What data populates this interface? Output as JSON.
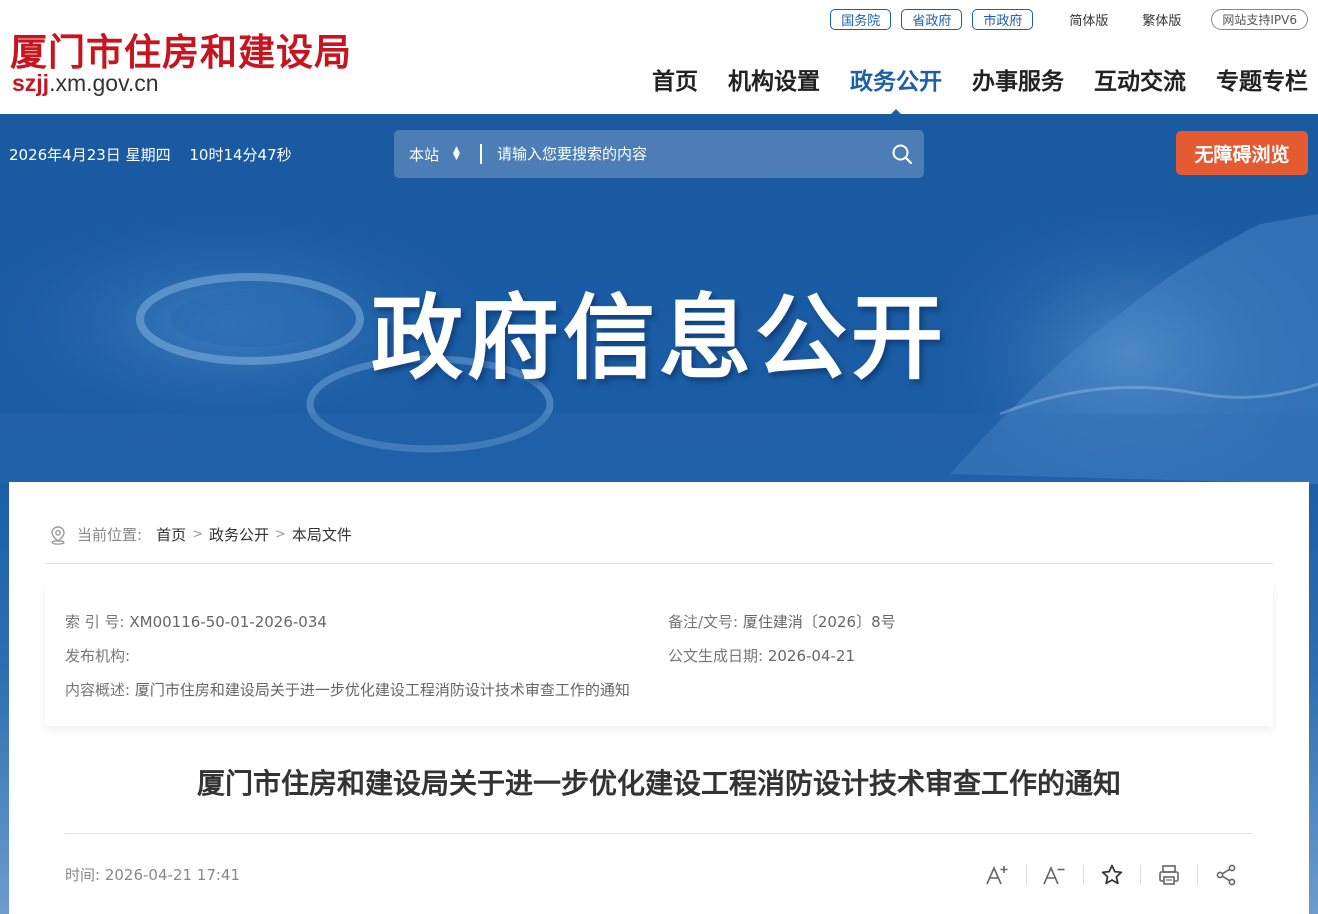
{
  "header": {
    "site_title": "厦门市住房和建设局",
    "domain_highlight": "szjj",
    "domain_rest": ".xm.gov.cn",
    "top_links": [
      {
        "label": "国务院"
      },
      {
        "label": "省政府"
      },
      {
        "label": "市政府"
      }
    ],
    "simplified": "简体版",
    "traditional": "繁体版",
    "ipv6": "网站支持IPV6",
    "nav": [
      {
        "label": "首页"
      },
      {
        "label": "机构设置"
      },
      {
        "label": "政务公开"
      },
      {
        "label": "办事服务"
      },
      {
        "label": "互动交流"
      },
      {
        "label": "专题专栏"
      }
    ],
    "active_nav": "政务公开"
  },
  "toolbar": {
    "date": "2026年4月23日 星期四",
    "time": "10时14分47秒",
    "search_scope": "本站",
    "search_placeholder": "请输入您要搜索的内容",
    "search_icon": "search-icon",
    "accessibility_label": "无障碍浏览"
  },
  "banner": {
    "title": "政府信息公开"
  },
  "breadcrumb": {
    "label": "当前位置:",
    "items": [
      "首页",
      "政务公开",
      "本局文件"
    ],
    "separator": ">"
  },
  "meta": {
    "index_label": "索 引 号:",
    "index_value": "XM00116-50-01-2026-034",
    "docno_label": "备注/文号:",
    "docno_value": "厦住建消〔2026〕8号",
    "publisher_label": "发布机构:",
    "publisher_value": "",
    "created_label": "公文生成日期:",
    "created_value": "2026-04-21",
    "summary_label": "内容概述:",
    "summary_value": "厦门市住房和建设局关于进一步优化建设工程消防设计技术审查工作的通知"
  },
  "article": {
    "title": "厦门市住房和建设局关于进一步优化建设工程消防设计技术审查工作的通知",
    "time_label": "时间:",
    "time_value": "2026-04-21 17:41",
    "tools": [
      "font-increase-icon",
      "font-decrease-icon",
      "star-icon",
      "print-icon",
      "share-icon"
    ]
  },
  "colors": {
    "brand_red": "#c8141e",
    "brand_blue": "#1d5fa6",
    "accessibility_orange": "#e45a33"
  }
}
